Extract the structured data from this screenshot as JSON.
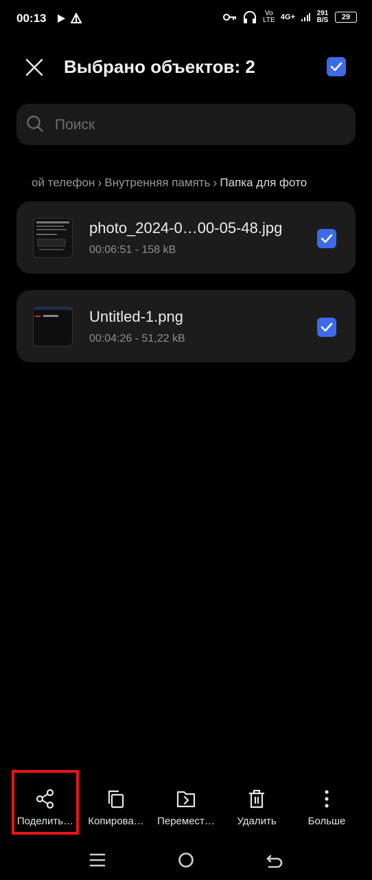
{
  "status_bar": {
    "time": "00:13",
    "volte": "Vo LTE",
    "network": "4G+",
    "speed": "291 B/S",
    "battery": "29"
  },
  "header": {
    "title": "Выбрано объектов: 2",
    "select_all_checked": true
  },
  "search": {
    "placeholder": "Поиск"
  },
  "breadcrumb": {
    "items": [
      "ой телефон",
      "Внутренняя память",
      "Папка для фото"
    ]
  },
  "files": [
    {
      "name": "photo_2024-0…00-05-48.jpg",
      "meta": "00:06:51 - 158 kB",
      "checked": true
    },
    {
      "name": "Untitled-1.png",
      "meta": "00:04:26 - 51,22 kB",
      "checked": true
    }
  ],
  "actions": {
    "share": "Поделить…",
    "copy": "Копирова…",
    "move": "Перемест…",
    "delete": "Удалить",
    "more": "Больше"
  },
  "colors": {
    "accent": "#3d6be8",
    "highlight": "#e8151b",
    "card": "#1c1c1c"
  }
}
